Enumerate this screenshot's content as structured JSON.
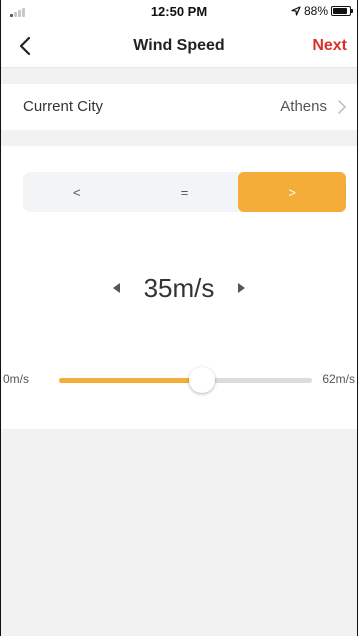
{
  "status_bar": {
    "time": "12:50 PM",
    "battery_text": "88%",
    "battery_level": 0.88,
    "signal_bars_active": 1,
    "icons": [
      "signal-icon",
      "location-arrow-icon",
      "battery-icon"
    ]
  },
  "nav": {
    "title": "Wind Speed",
    "next_label": "Next",
    "back_icon": "chevron-left-icon",
    "next_color": "#d9312a"
  },
  "city": {
    "label": "Current City",
    "value": "Athens",
    "chevron_icon": "chevron-right-icon"
  },
  "comparator": {
    "options": [
      "<",
      "=",
      ">"
    ],
    "selected_index": 2,
    "accent_color": "#f3ad38"
  },
  "speed": {
    "value_text": "35m/s",
    "decrease_icon": "triangle-left-icon",
    "increase_icon": "triangle-right-icon"
  },
  "slider": {
    "min_label": "0m/s",
    "max_label": "62m/s",
    "min": 0,
    "max": 62,
    "value": 35
  }
}
